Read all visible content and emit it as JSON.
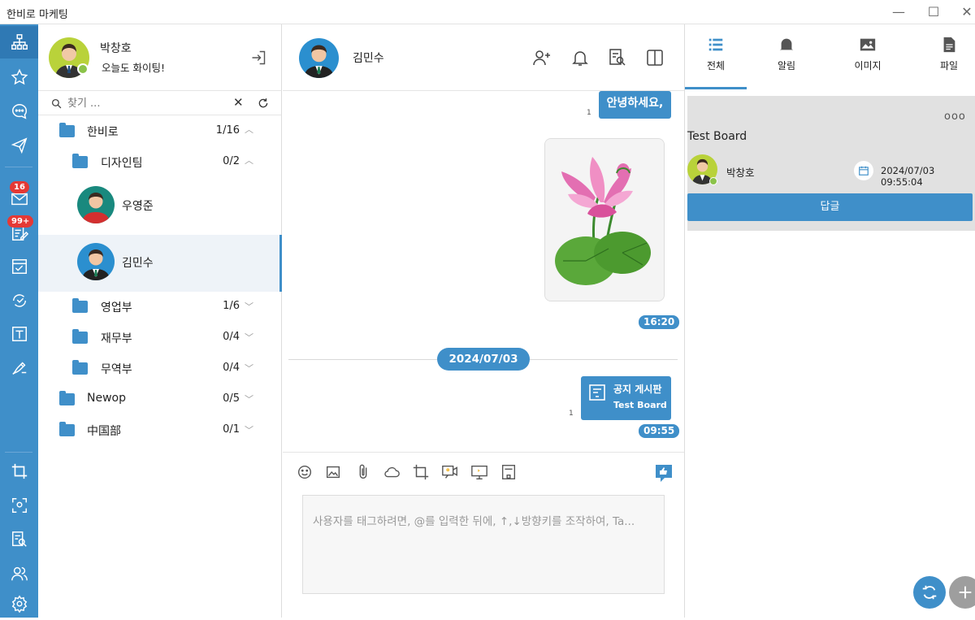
{
  "app": {
    "title": "한비로 마케팅",
    "minimize": "—",
    "maximize": "☐",
    "close": "✕"
  },
  "badges": {
    "mail": "16",
    "board": "99+"
  },
  "me": {
    "name": "박창호",
    "status": "오늘도 화이팅!"
  },
  "search": {
    "placeholder": "찾기 ..."
  },
  "tree": [
    {
      "label": "한비로",
      "count": "1/16",
      "chev": "︿"
    },
    {
      "label": "디자인팀",
      "count": "0/2",
      "chev": "︿"
    },
    {
      "label": "우영준"
    },
    {
      "label": "김민수"
    },
    {
      "label": "영업부",
      "count": "1/6",
      "chev": "﹀"
    },
    {
      "label": "재무부",
      "count": "0/4",
      "chev": "﹀"
    },
    {
      "label": "무역부",
      "count": "0/4",
      "chev": "﹀"
    },
    {
      "label": "Newop",
      "count": "0/5",
      "chev": "﹀"
    },
    {
      "label": "中国部",
      "count": "0/1",
      "chev": "﹀"
    }
  ],
  "chat": {
    "partner": "김민수",
    "msg1": "안녕하세요,",
    "read1": "1",
    "time1": "16:20",
    "date": "2024/07/03",
    "notice_title": "공지 게시판",
    "notice_sub": "Test Board",
    "read2": "1",
    "time2": "09:55",
    "input_placeholder": "사용자를 태그하려면, @를 입력한 뒤에, ↑,↓방향키를 조작하여, Ta..."
  },
  "right": {
    "tabs": [
      "전체",
      "알림",
      "이미지",
      "파일"
    ],
    "card": {
      "more": "ooo",
      "title": "Test Board",
      "author": "박창호",
      "datetime": "2024/07/03 09:55:04",
      "reply": "답글"
    }
  },
  "colors": {
    "accent": "#3f8fc9",
    "rail": "#3f8fc9"
  }
}
